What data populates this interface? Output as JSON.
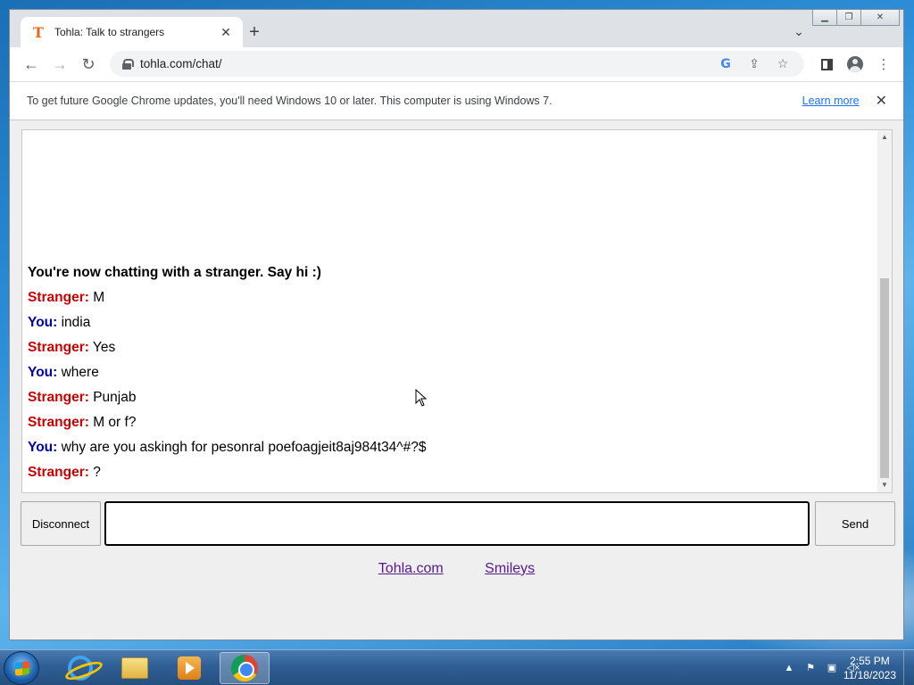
{
  "browser": {
    "tab_title": "Tohla: Talk to strangers",
    "tab_favicon": "T",
    "url": "tohla.com/chat/",
    "infobar_text": "To get future Google Chrome updates, you'll need Windows 10 or later. This computer is using Windows 7.",
    "learn_more": "Learn more"
  },
  "chat": {
    "system_message": "You're now chatting with a stranger. Say hi :)",
    "stranger_label": "Stranger:",
    "you_label": "You:",
    "messages": [
      {
        "who": "Stranger:",
        "text": " M"
      },
      {
        "who": "You:",
        "text": " india"
      },
      {
        "who": "Stranger:",
        "text": " Yes"
      },
      {
        "who": "You:",
        "text": " where"
      },
      {
        "who": "Stranger:",
        "text": " Punjab"
      },
      {
        "who": "Stranger:",
        "text": " M or f?"
      },
      {
        "who": "You:",
        "text": " why are you askingh for pesonral poefoagjeit8aj984t34^#?$"
      },
      {
        "who": "Stranger:",
        "text": " ?"
      }
    ],
    "input_value": "",
    "disconnect_label": "Disconnect",
    "send_label": "Send"
  },
  "footer": {
    "link_home": "Tohla.com",
    "link_smileys": "Smileys"
  },
  "taskbar": {
    "time": "2:55 PM",
    "date": "11/18/2023"
  },
  "colors": {
    "stranger": "#cc0000",
    "you": "#0000b3"
  }
}
